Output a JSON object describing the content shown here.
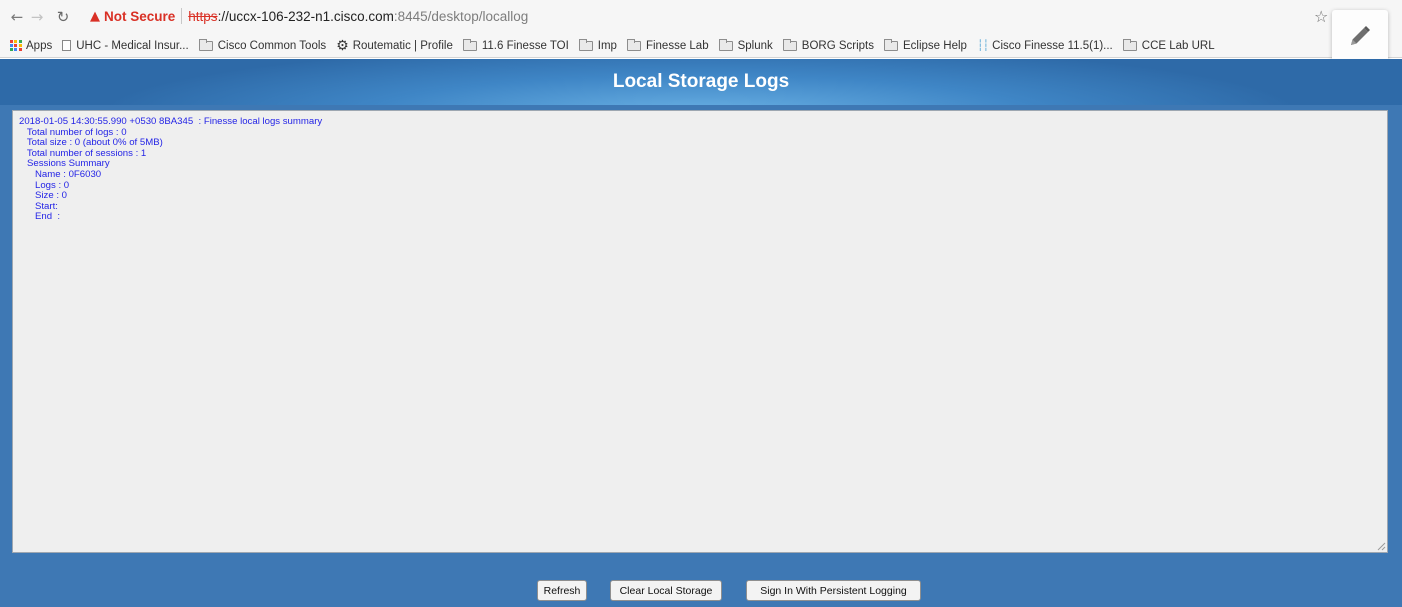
{
  "browser": {
    "not_secure": "Not Secure",
    "url_scheme": "https",
    "url_host": "://uccx-106-232-n1.cisco.com",
    "url_rest": ":8445/desktop/locallog"
  },
  "bookmarks": [
    {
      "label": "Apps",
      "icon": "apps-grid-icon"
    },
    {
      "label": "UHC - Medical Insur...",
      "icon": "page-icon"
    },
    {
      "label": "Cisco Common Tools",
      "icon": "folder-icon"
    },
    {
      "label": "Routematic | Profile",
      "icon": "gear-icon"
    },
    {
      "label": "11.6 Finesse TOI",
      "icon": "folder-icon"
    },
    {
      "label": "Imp",
      "icon": "folder-icon"
    },
    {
      "label": "Finesse Lab",
      "icon": "folder-icon"
    },
    {
      "label": "Splunk",
      "icon": "folder-icon"
    },
    {
      "label": "BORG Scripts",
      "icon": "folder-icon"
    },
    {
      "label": "Eclipse Help",
      "icon": "folder-icon"
    },
    {
      "label": "Cisco Finesse 11.5(1)...",
      "icon": "cisco-icon"
    },
    {
      "label": "CCE Lab URL",
      "icon": "folder-icon"
    }
  ],
  "page": {
    "title": "Local Storage Logs"
  },
  "log": {
    "lines": [
      "2018-01-05 14:30:55.990 +0530 8BA345  : Finesse local logs summary",
      "   Total number of logs : 0",
      "   Total size : 0 (about 0% of 5MB)",
      "   Total number of sessions : 1",
      "   Sessions Summary",
      "      Name : 0F6030",
      "      Logs : 0",
      "      Size : 0",
      "      Start:",
      "      End  :"
    ]
  },
  "buttons": {
    "refresh": "Refresh",
    "clear": "Clear Local Storage",
    "signin": "Sign In With Persistent Logging"
  },
  "colors": {
    "page_bg": "#3e78b4",
    "log_text": "#2424e6",
    "warning": "#d93025"
  }
}
